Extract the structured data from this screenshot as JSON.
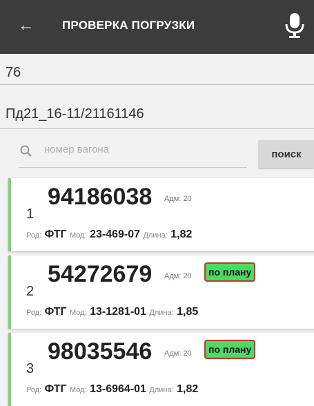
{
  "header": {
    "title": "ПРОВЕРКА ПОГРУЗКИ",
    "back_icon": "arrow-left-icon",
    "mic_icon": "microphone-icon"
  },
  "fields": {
    "field1_value": "76",
    "field2_value": "Пд21_16-11/21161146"
  },
  "search": {
    "placeholder": "номер вагона",
    "button_label": "поиск"
  },
  "colors": {
    "appbar": "#3c3c3c",
    "accent_green": "#7ed47a",
    "plan_badge": "#4cd964",
    "plan_badge_border": "#c0392b"
  },
  "cards": [
    {
      "index": "1",
      "number": "94186038",
      "adm_label": "Адм:",
      "adm_value": "20",
      "plan_badge": "",
      "rod_label": "Род:",
      "rod_value": "ФТГ",
      "mod_label": "Мод:",
      "mod_value": "23-469-07",
      "len_label": "Длина:",
      "len_value": "1,82"
    },
    {
      "index": "2",
      "number": "54272679",
      "adm_label": "Адм:",
      "adm_value": "20",
      "plan_badge": "по плану",
      "rod_label": "Род:",
      "rod_value": "ФТГ",
      "mod_label": "Мод:",
      "mod_value": "13-1281-01",
      "len_label": "Длина:",
      "len_value": "1,85"
    },
    {
      "index": "3",
      "number": "98035546",
      "adm_label": "Адм:",
      "adm_value": "20",
      "plan_badge": "по плану",
      "rod_label": "Род:",
      "rod_value": "ФТГ",
      "mod_label": "Мод:",
      "mod_value": "13-6964-01",
      "len_label": "Длина:",
      "len_value": "1,82"
    }
  ]
}
